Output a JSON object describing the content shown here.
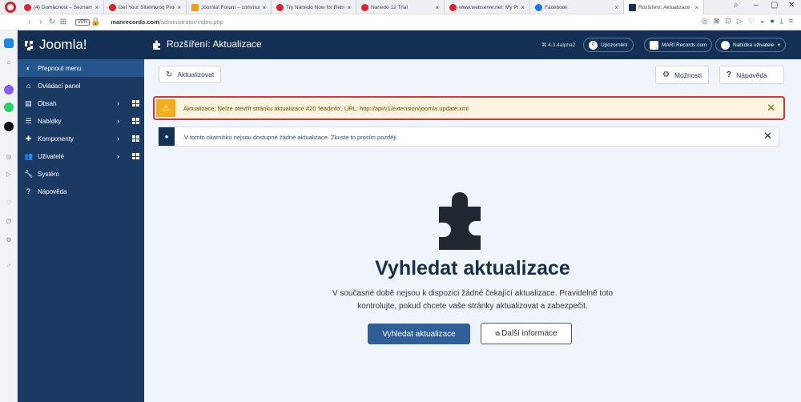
{
  "browser": {
    "tabs": [
      {
        "title": "(4) Domácnost – Seznam Z...",
        "color": "#e0212b"
      },
      {
        "title": "Get Your Sitelinkroq Products...",
        "color": "#e0212b"
      },
      {
        "title": "Joomla! Forum – community...",
        "color": "#f39c12"
      },
      {
        "title": "Try Nanedo Now for Rebuild...",
        "color": "#e0212b"
      },
      {
        "title": "Nanedo 12 Trial",
        "color": "#e0212b"
      },
      {
        "title": "www.webserve.net: My Prog...",
        "color": "#e0212b"
      },
      {
        "title": "Facebook",
        "color": "#1877f2"
      },
      {
        "title": "Rozšíření: Aktualizace - Ma...",
        "color": "#132f53"
      }
    ],
    "tab_close": "×",
    "vpn": "VPN",
    "url_host": "manrecords.com",
    "url_path": "/administrator/index.php"
  },
  "header": {
    "logo": "Joomla!",
    "title": "Rozšíření: Aktualizace",
    "version": "⌘ 4.3.4alpha2",
    "notifications_count": "0",
    "notifications_label": "Upozornění",
    "site_label": "MARI Records.com",
    "user_label": "Nabídka uživatele"
  },
  "sidebar": {
    "toggle": "Přepnout menu",
    "items": [
      {
        "label": "Ovládací panel",
        "icon": "⌂"
      },
      {
        "label": "Obsah",
        "icon": "▤"
      },
      {
        "label": "Nabídky",
        "icon": "☰"
      },
      {
        "label": "Komponenty",
        "icon": "✚"
      },
      {
        "label": "Uživatelé",
        "icon": "👥"
      },
      {
        "label": "Systém",
        "icon": "🔧"
      },
      {
        "label": "Nápověda",
        "icon": "?"
      }
    ]
  },
  "toolbar": {
    "refresh": "Aktualizovat",
    "options": "Možnosti",
    "help": "Nápověda"
  },
  "alerts": {
    "warning": "Aktualizace: Nelze otevřít stránku aktualizace #20 'leadinfo', URL: http://api/v1/extension/joomla.update.xml",
    "info": "V tomto okamžiku nejsou dostupné žádné aktualizace. Zkuste to prosím později."
  },
  "empty_state": {
    "title": "Vyhledat aktualizace",
    "text": "V současné době nejsou k dispozici žádné čekající aktualizace. Pravidelně toto kontrolujte, pokud chcete vaše stránky aktualizovat a zabezpečit.",
    "search_button": "Vyhledat aktualizace",
    "more_button": "Další informace"
  },
  "colors": {
    "header": "#132f53",
    "sidebar": "#1a3a64",
    "warning": "#f0ad19",
    "primary": "#2f5f98"
  }
}
